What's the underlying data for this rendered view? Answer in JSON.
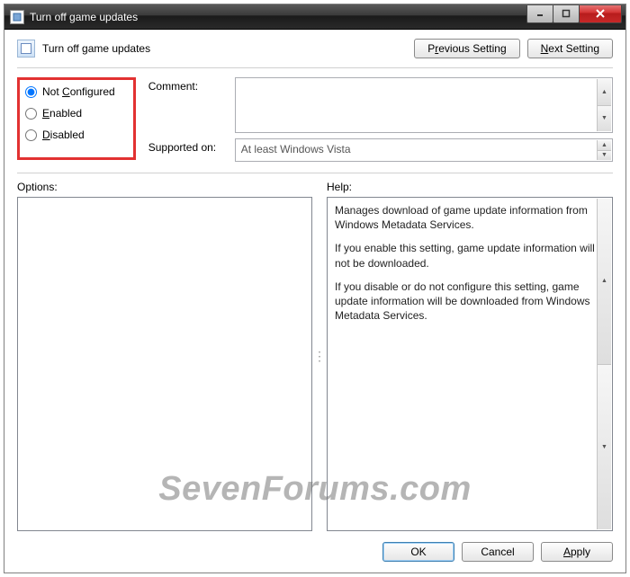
{
  "window": {
    "title": "Turn off game updates"
  },
  "header": {
    "policy_title": "Turn off game updates",
    "prev_label_pre": "P",
    "prev_label_ul": "r",
    "prev_label_post": "evious Setting",
    "next_label_ul": "N",
    "next_label_post": "ext Setting"
  },
  "radios": {
    "not_configured_pre": "Not ",
    "not_configured_ul": "C",
    "not_configured_post": "onfigured",
    "enabled_ul": "E",
    "enabled_post": "nabled",
    "disabled_ul": "D",
    "disabled_post": "isabled",
    "selected": "not_configured"
  },
  "fields": {
    "comment_label": "Comment:",
    "comment_value": "",
    "supported_label": "Supported on:",
    "supported_value": "At least Windows Vista"
  },
  "panels": {
    "options_label": "Options:",
    "help_label": "Help:",
    "help_p1": "Manages download of game update information from Windows Metadata Services.",
    "help_p2": "If you enable this setting, game update information will not be downloaded.",
    "help_p3": "If you disable or do not configure this setting, game update information will be downloaded from Windows Metadata Services."
  },
  "footer": {
    "ok": "OK",
    "cancel": "Cancel",
    "apply_ul": "A",
    "apply_post": "pply"
  },
  "watermark": "SevenForums.com"
}
